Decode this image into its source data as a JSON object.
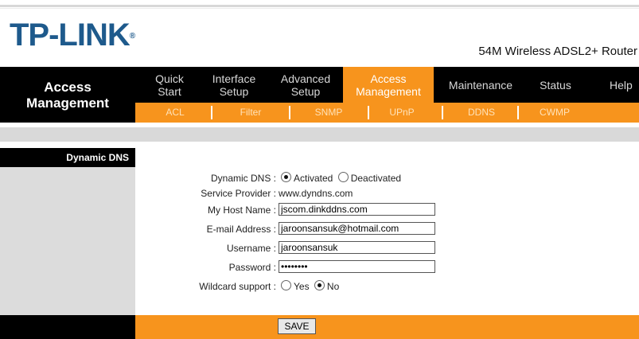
{
  "brand": {
    "logo": "TP-LINK",
    "trademark": "®",
    "model": "54M Wireless ADSL2+ Router"
  },
  "sidebar": {
    "title_line1": "Access",
    "title_line2": "Management",
    "section": "Dynamic DNS"
  },
  "nav": {
    "tabs": [
      {
        "line1": "Quick",
        "line2": "Start"
      },
      {
        "line1": "Interface",
        "line2": "Setup"
      },
      {
        "line1": "Advanced",
        "line2": "Setup"
      },
      {
        "line1": "Access",
        "line2": "Management"
      },
      {
        "line1": "Maintenance",
        "line2": ""
      },
      {
        "line1": "Status",
        "line2": ""
      },
      {
        "line1": "Help",
        "line2": ""
      }
    ],
    "subtabs": [
      "ACL",
      "Filter",
      "SNMP",
      "UPnP",
      "DDNS",
      "CWMP"
    ]
  },
  "form": {
    "ddns_label": "Dynamic DNS :",
    "ddns_activated": "Activated",
    "ddns_deactivated": "Deactivated",
    "provider_label": "Service Provider :",
    "provider_value": "www.dyndns.com",
    "host_label": "My Host Name :",
    "host_value": "jscom.dinkddns.com",
    "email_label": "E-mail Address :",
    "email_value": "jaroonsansuk@hotmail.com",
    "username_label": "Username :",
    "username_value": "jaroonsansuk",
    "password_label": "Password :",
    "password_value": "••••••••",
    "wildcard_label": "Wildcard support :",
    "wildcard_yes": "Yes",
    "wildcard_no": "No"
  },
  "footer": {
    "save_label": "SAVE"
  },
  "colors": {
    "accent": "#f7941d",
    "logo": "#1e5a8c",
    "header": "#000000"
  }
}
